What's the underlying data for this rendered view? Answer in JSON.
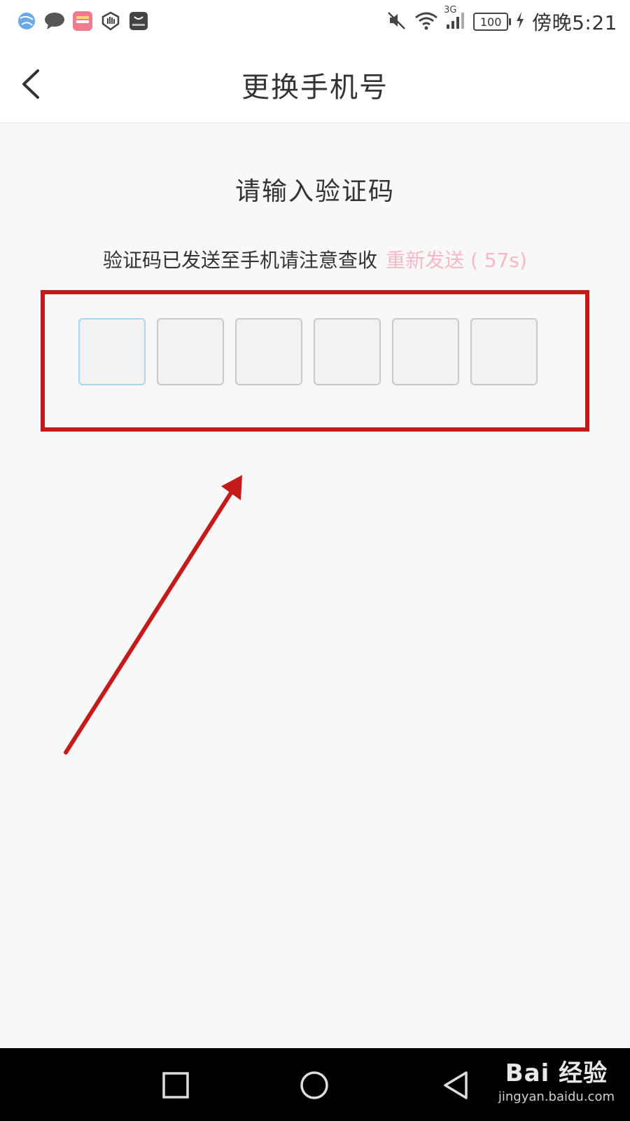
{
  "status_bar": {
    "time": "傍晚5:21",
    "battery": "100",
    "network": "3G",
    "left_icons": [
      "browser-icon",
      "message-icon",
      "app-icon",
      "shield-hand-icon",
      "huawei-store-icon"
    ],
    "right_icons": [
      "mute-icon",
      "wifi-icon",
      "signal-icon",
      "battery-icon",
      "charging-icon"
    ]
  },
  "header": {
    "title": "更换手机号",
    "back_icon": "chevron-left-icon"
  },
  "main": {
    "section_title": "请输入验证码",
    "hint": "验证码已发送至手机请注意查收",
    "resend_label": "重新发送 ( 57s)",
    "code_digits": [
      "",
      "",
      "",
      "",
      "",
      ""
    ],
    "active_index": 0
  },
  "annotation": {
    "box_color": "#c51a1a",
    "arrow_color": "#c51a1a"
  },
  "nav_bar": {
    "buttons": [
      "square-icon",
      "circle-icon",
      "triangle-back-icon"
    ]
  },
  "watermark": {
    "logo": "Bai 经验",
    "url": "jingyan.baidu.com"
  }
}
